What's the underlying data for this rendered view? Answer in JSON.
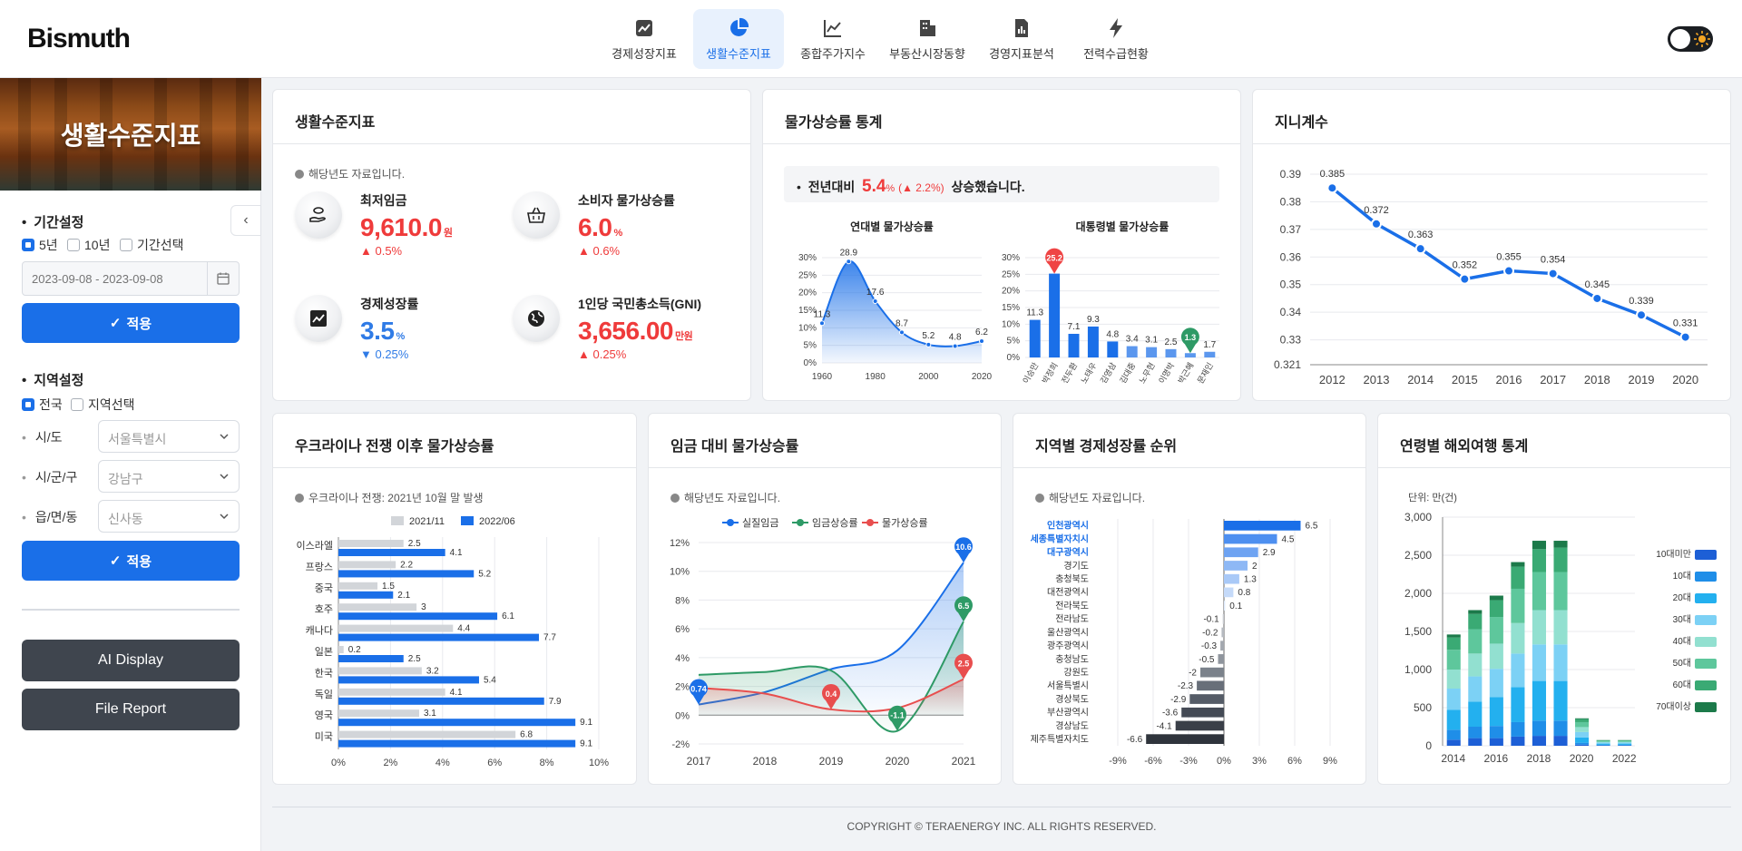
{
  "app": {
    "logo": "Bismuth"
  },
  "nav": [
    {
      "label": "경제성장지표",
      "icon": "chart-box-icon"
    },
    {
      "label": "생활수준지표",
      "icon": "pie-chart-icon"
    },
    {
      "label": "종합주가지수",
      "icon": "line-chart-icon"
    },
    {
      "label": "부동산시장동향",
      "icon": "building-icon"
    },
    {
      "label": "경영지표분석",
      "icon": "document-chart-icon"
    },
    {
      "label": "전력수급현황",
      "icon": "lightning-icon"
    }
  ],
  "nav_active": "생활수준지표",
  "sidebar": {
    "banner_title": "생활수준지표",
    "period_title": "기간설정",
    "period_options": [
      "5년",
      "10년",
      "기간선택"
    ],
    "date_placeholder": "2023-09-08 - 2023-09-08",
    "apply_label": "적용",
    "region_title": "지역설정",
    "region_options": [
      "전국",
      "지역선택"
    ],
    "sido_label": "시/도",
    "sido_value": "서울특별시",
    "sigungu_label": "시/군/구",
    "sigungu_value": "강남구",
    "dong_label": "읍/면/동",
    "dong_value": "신사동",
    "ai_display": "AI Display",
    "file_report": "File Report"
  },
  "living": {
    "title": "생활수준지표",
    "note": "해당년도 자료입니다.",
    "kpis": [
      {
        "label": "최저임금",
        "value": "9,610.0",
        "unit": "원",
        "change": "▲ 0.5%",
        "color": "red",
        "icon": "money-hand-icon"
      },
      {
        "label": "소비자 물가상승률",
        "value": "6.0",
        "unit": "%",
        "change": "▲ 0.6%",
        "color": "red",
        "icon": "basket-icon"
      },
      {
        "label": "경제성장률",
        "value": "3.5",
        "unit": "%",
        "change": "▼ 0.25%",
        "color": "blue",
        "icon": "trend-up-icon"
      },
      {
        "label": "1인당 국민총소득(GNI)",
        "value": "3,656.00",
        "unit": "만원",
        "change": "▲ 0.25%",
        "color": "red",
        "icon": "globe-icon"
      }
    ]
  },
  "inflation": {
    "title": "물가상승률 통계",
    "info_prefix": "전년대비",
    "info_value": "5.4",
    "info_unit": "%",
    "info_change": "(▲ 2.2%)",
    "info_suffix": "상승했습니다."
  },
  "gini": {
    "title": "지니계수"
  },
  "ukraine": {
    "title": "우크라이나 전쟁 이후 물가상승률",
    "note": "우크라이나 전쟁: 2021년 10월 말 발생"
  },
  "wage": {
    "title": "임금 대비 물가상승률",
    "note": "해당년도 자료입니다."
  },
  "regional": {
    "title": "지역별 경제성장률 순위",
    "note": "해당년도 자료입니다."
  },
  "travel": {
    "title": "연령별 해외여행 통계",
    "unit_label": "단위: 만(건)"
  },
  "footer": "COPYRIGHT © TERAENERGY INC. ALL RIGHTS RESERVED.",
  "chart_data": [
    {
      "type": "area",
      "title": "연대별 물가상승률",
      "x": [
        1960,
        1970,
        1980,
        1990,
        2000,
        2010,
        2020
      ],
      "values": [
        11.3,
        28.9,
        17.6,
        8.7,
        5.2,
        4.8,
        6.2
      ],
      "x_ticks": [
        "1960",
        "1980",
        "2000",
        "2020"
      ],
      "y_ticks": [
        "0%",
        "5%",
        "10%",
        "15%",
        "20%",
        "25%",
        "30%"
      ],
      "ylim": [
        0,
        30
      ]
    },
    {
      "type": "bar",
      "title": "대통령별 물가상승률",
      "categories": [
        "이승만",
        "박정희",
        "전두환",
        "노태우",
        "김영삼",
        "김대중",
        "노무현",
        "이명박",
        "박근혜",
        "문재인"
      ],
      "values": [
        11.3,
        25.2,
        7.1,
        9.3,
        4.8,
        3.4,
        3.1,
        2.5,
        1.3,
        1.7
      ],
      "y_ticks": [
        "0%",
        "5%",
        "10%",
        "15%",
        "20%",
        "25%",
        "30%"
      ],
      "ylim": [
        0,
        30
      ]
    },
    {
      "type": "line",
      "title": "지니계수",
      "x": [
        "2012",
        "2013",
        "2014",
        "2015",
        "2016",
        "2017",
        "2018",
        "2019",
        "2020"
      ],
      "values": [
        0.385,
        0.372,
        0.363,
        0.352,
        0.355,
        0.354,
        0.345,
        0.339,
        0.331
      ],
      "y_ticks": [
        "0.321",
        "0.33",
        "0.34",
        "0.35",
        "0.36",
        "0.37",
        "0.38",
        "0.39"
      ],
      "ylim": [
        0.321,
        0.39
      ]
    },
    {
      "type": "bar",
      "title": "우크라이나 전쟁 이후 물가상승률",
      "categories": [
        "이스라엘",
        "프랑스",
        "중국",
        "호주",
        "캐나다",
        "일본",
        "한국",
        "독일",
        "영국",
        "미국"
      ],
      "series": [
        {
          "name": "2021/11",
          "values": [
            2.5,
            2.2,
            1.5,
            3,
            4.4,
            0.2,
            3.2,
            4.1,
            3.1,
            6.8
          ],
          "color": "#d2d5d9"
        },
        {
          "name": "2022/06",
          "values": [
            4.1,
            5.2,
            2.1,
            6.1,
            7.7,
            2.5,
            5.4,
            7.9,
            9.1,
            9.1
          ],
          "color": "#1a6fe8"
        }
      ],
      "x_ticks": [
        "0%",
        "2%",
        "4%",
        "6%",
        "8%",
        "10%"
      ],
      "xlim": [
        0,
        10
      ]
    },
    {
      "type": "line",
      "title": "임금 대비 물가상승률",
      "x": [
        "2017",
        "2018",
        "2019",
        "2020",
        "2021"
      ],
      "series": [
        {
          "name": "실질임금",
          "values": [
            0.74,
            1.6,
            3.2,
            4.5,
            10.6
          ],
          "color": "#1a6fe8"
        },
        {
          "name": "임금상승률",
          "values": [
            2.8,
            3.0,
            3.1,
            -1.1,
            6.5
          ],
          "color": "#2e9a66"
        },
        {
          "name": "물가상승률",
          "values": [
            1.9,
            1.5,
            0.4,
            0.5,
            2.5
          ],
          "color": "#e84e4e"
        }
      ],
      "y_ticks": [
        "-2%",
        "0%",
        "2%",
        "4%",
        "6%",
        "8%",
        "10%",
        "12%"
      ],
      "ylim": [
        -2,
        12
      ],
      "markers": [
        "0.74",
        "0.4",
        "-1.1",
        "10.6",
        "6.5",
        "2.5"
      ]
    },
    {
      "type": "bar",
      "title": "지역별 경제성장률 순위",
      "categories": [
        "인천광역시",
        "세종특별자치시",
        "대구광역시",
        "경기도",
        "충청북도",
        "대전광역시",
        "전라북도",
        "전라남도",
        "울산광역시",
        "광주광역시",
        "충청남도",
        "강원도",
        "서울특별시",
        "경상북도",
        "부산광역시",
        "경상남도",
        "제주특별자치도"
      ],
      "values": [
        6.5,
        4.5,
        2.9,
        2,
        1.3,
        0.8,
        0.1,
        -0.1,
        -0.2,
        -0.3,
        -0.5,
        -2,
        -2.3,
        -2.9,
        -3.6,
        -4.1,
        -6.6
      ],
      "x_ticks": [
        "-9%",
        "-6%",
        "-3%",
        "0%",
        "3%",
        "6%",
        "9%"
      ],
      "xlim": [
        -9,
        9
      ]
    },
    {
      "type": "bar",
      "title": "연령별 해외여행 통계",
      "ylabel": "단위: 만(건)",
      "categories": [
        "2014",
        "2015",
        "2016",
        "2017",
        "2018",
        "2019",
        "2020",
        "2021",
        "2022"
      ],
      "x_ticks": [
        "2014",
        "2016",
        "2018",
        "2020",
        "2022"
      ],
      "y_ticks": [
        "0",
        "500",
        "1,000",
        "1,500",
        "2,000",
        "2,500",
        "3,000"
      ],
      "ylim": [
        0,
        3000
      ],
      "series": [
        {
          "name": "10대미만",
          "values": [
            80,
            100,
            100,
            120,
            130,
            130,
            15,
            5,
            5
          ],
          "color": "#1d5fd6"
        },
        {
          "name": "10대",
          "values": [
            130,
            150,
            160,
            190,
            200,
            200,
            25,
            8,
            8
          ],
          "color": "#1f8ee8"
        },
        {
          "name": "20대",
          "values": [
            260,
            330,
            380,
            460,
            520,
            520,
            70,
            15,
            15
          ],
          "color": "#23b0ef"
        },
        {
          "name": "30대",
          "values": [
            280,
            330,
            370,
            440,
            480,
            480,
            70,
            15,
            15
          ],
          "color": "#7cd1f5"
        },
        {
          "name": "40대",
          "values": [
            250,
            300,
            330,
            400,
            450,
            450,
            65,
            10,
            10
          ],
          "color": "#92e0d0"
        },
        {
          "name": "50대",
          "values": [
            260,
            320,
            350,
            450,
            500,
            500,
            65,
            12,
            12
          ],
          "color": "#5ec79c"
        },
        {
          "name": "60대",
          "values": [
            160,
            200,
            220,
            290,
            300,
            320,
            40,
            8,
            8
          ],
          "color": "#3aaa74"
        },
        {
          "name": "70대이상",
          "values": [
            40,
            50,
            60,
            60,
            110,
            90,
            10,
            2,
            2
          ],
          "color": "#1c7a4a"
        }
      ]
    }
  ]
}
